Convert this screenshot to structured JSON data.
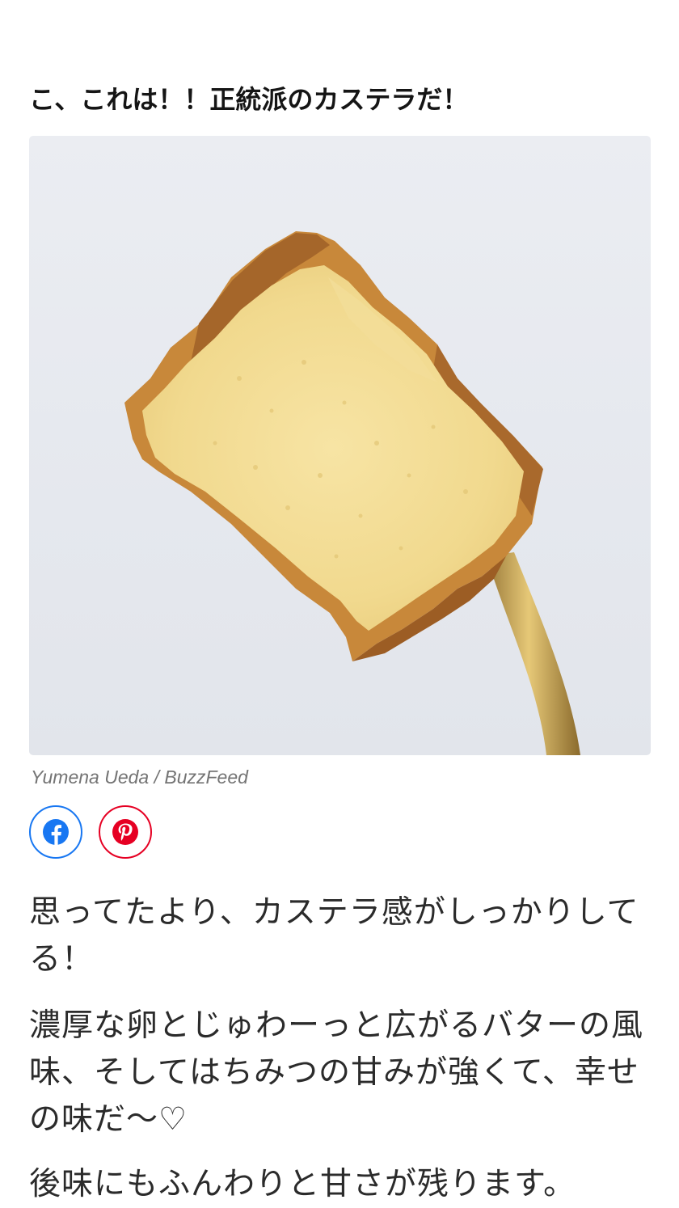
{
  "article": {
    "heading": "こ、これは！！正統派のカステラだ！",
    "photo": {
      "alt": "",
      "credit": "Yumena Ueda / BuzzFeed"
    },
    "share": {
      "facebook_icon": "facebook-icon",
      "pinterest_icon": "pinterest-icon"
    },
    "paragraphs": [
      "思ってたより、カステラ感がしっかりしてる！",
      "濃厚な卵とじゅわーっと広がるバターの風味、そしてはちみつの甘みが強くて、幸せの味だ〜♡",
      "後味にもふんわりと甘さが残ります。"
    ]
  },
  "colors": {
    "facebook": "#1877f2",
    "pinterest": "#e60023",
    "credit": "#747474",
    "text": "#2b2b2b",
    "heading": "#151515"
  }
}
